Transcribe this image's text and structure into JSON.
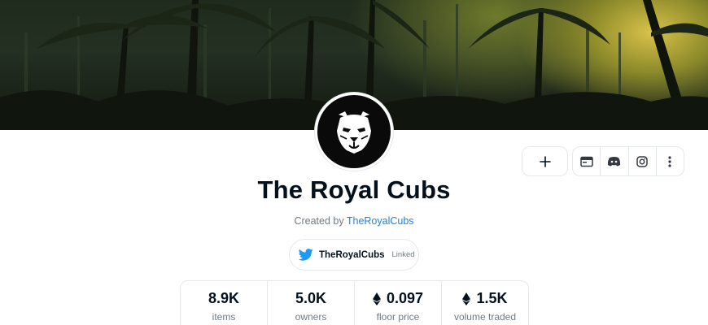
{
  "collection": {
    "name": "The Royal Cubs",
    "created_by_prefix": "Created by",
    "creator": "TheRoyalCubs"
  },
  "banner": {
    "icon": "jungle-palm-trees-image"
  },
  "avatar": {
    "icon": "lion-cub-head-icon"
  },
  "actions": {
    "add_icon": "plus-icon",
    "socials": [
      "website-icon",
      "discord-icon",
      "instagram-icon",
      "more-vertical-icon"
    ]
  },
  "twitter": {
    "handle": "TheRoyalCubs",
    "status": "Linked",
    "icon": "twitter-icon",
    "color": "#1d9bf0"
  },
  "stats": [
    {
      "value": "8.9K",
      "label": "items",
      "eth": false
    },
    {
      "value": "5.0K",
      "label": "owners",
      "eth": false
    },
    {
      "value": "0.097",
      "label": "floor price",
      "eth": true
    },
    {
      "value": "1.5K",
      "label": "volume traded",
      "eth": true
    }
  ],
  "colors": {
    "link": "#2081e2",
    "text": "#04111d",
    "muted": "#707a83",
    "border": "#e5e8eb"
  }
}
